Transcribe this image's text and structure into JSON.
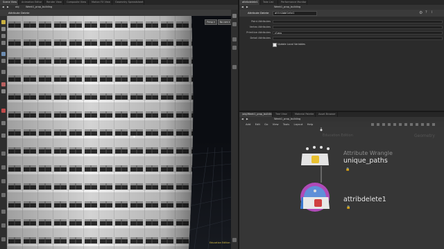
{
  "left_tabs": [
    "Scene View",
    "Animation Editor",
    "Render View",
    "Composite View",
    "Motion FX View",
    "Geometry Spreadsheet"
  ],
  "left_path": "Week1_prop_building",
  "left_obj": "obj",
  "node_label": "Attribute Delete",
  "viewport": {
    "persp": "Persp ▾",
    "cam": "No cam ▾",
    "edition": "Education Edition"
  },
  "right_tabs_top": [
    "attribdelete1",
    "Take List",
    "Performance Monitor"
  ],
  "right_top_path": "Week1_prop_building",
  "parm_header": {
    "type": "Attribute Delete",
    "name": "attribdelete1"
  },
  "parms": [
    {
      "label": "Point Attributes",
      "value": ""
    },
    {
      "label": "Vertex Attributes",
      "value": ""
    },
    {
      "label": "Primitive Attributes",
      "value": "class"
    },
    {
      "label": "Detail Attributes",
      "value": ""
    }
  ],
  "update_local": "Update Local Variables",
  "right_tabs_bottom": [
    "/obj/Week1_prop_building",
    "Tree View",
    "Material Palette",
    "Asset Browser"
  ],
  "right_bottom_path": "Week1_prop_building",
  "menu": [
    "Add",
    "Edit",
    "Go",
    "View",
    "Tools",
    "Layout",
    "Help"
  ],
  "network": {
    "ghost_label": "Education Edition",
    "context_label": "Geometry",
    "wrangle_type": "Attribute Wrangle",
    "wrangle_name": "unique_paths",
    "delete_name": "attribdelete1"
  },
  "colors": {
    "accent_select": "#5aa0e0",
    "display_flag": "#c050c8"
  }
}
